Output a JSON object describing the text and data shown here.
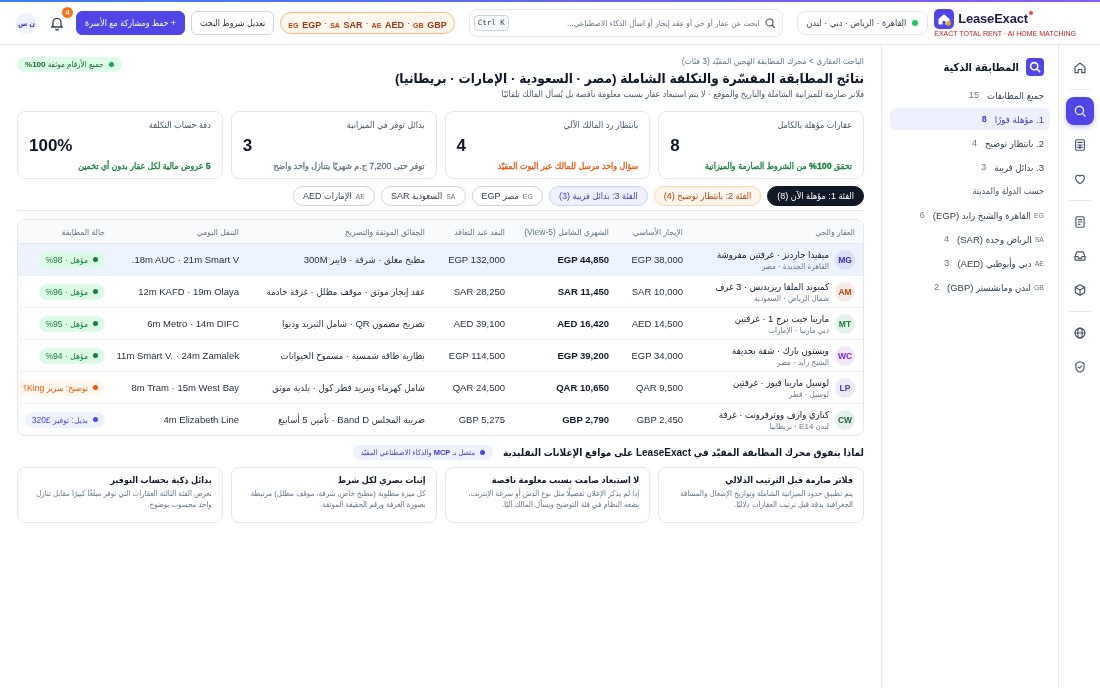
{
  "top_bar": {
    "brand": {
      "name": "LeaseExact",
      "tagline": "EXACT TOTAL RENT · AI HOME MATCHING"
    },
    "location": "القاهرة · الرياض · دبي · لندن",
    "search": {
      "placeholder": "ابحث عن عقار أو حي أو عقد إيجار أو اسأل الذكاء الاصطناعي...",
      "shortcut": "Ctrl K"
    },
    "currencies": {
      "separator": "·",
      "items": [
        {
          "flag": "GB",
          "code": "GBP"
        },
        {
          "flag": "AE",
          "code": "AED"
        },
        {
          "flag": "SA",
          "code": "SAR"
        },
        {
          "flag": "EG",
          "code": "EGP"
        }
      ]
    },
    "buttons": [
      {
        "label": "تعديل شروط البحث",
        "kind": "secondary"
      },
      {
        "label": "+ حفظ ومشاركة مع الأسرة",
        "kind": "primary"
      }
    ],
    "notifications": "4",
    "user_initials": "ن س"
  },
  "nav_rail": [
    {
      "selected": false
    },
    {
      "selected": true
    },
    {
      "selected": false
    },
    {
      "selected": false
    },
    {
      "selected": false
    },
    {
      "selected": false
    },
    {
      "selected": false
    },
    {
      "selected": false
    },
    {
      "selected": false
    }
  ],
  "sidebar": {
    "title": "المطابقة الذكية",
    "items": [
      {
        "label": "جميع المطابقات",
        "count": "15",
        "selected": false
      },
      {
        "label": "1. مؤهلة فورًا",
        "count": "8",
        "selected": true
      },
      {
        "label": "2. بانتظار توضيح",
        "count": "4",
        "selected": false
      },
      {
        "label": "3. بدائل قريبة",
        "count": "3",
        "selected": false
      }
    ],
    "section": "حسب الدولة والمدينة",
    "regions": [
      {
        "code": "EG",
        "label": "القاهرة والشيخ زايد (EGP)",
        "count": "6",
        "selected": false
      },
      {
        "code": "SA",
        "label": "الرياض وجدة (SAR)",
        "count": "4",
        "selected": false
      },
      {
        "code": "AE",
        "label": "دبي وأبوظبي (AED)",
        "count": "3",
        "selected": false
      },
      {
        "code": "GB",
        "label": "لندن ومانشستر (GBP)",
        "count": "2",
        "selected": false
      }
    ]
  },
  "header": {
    "breadcrumb": "الباحث العقاري > محرك المطابقة الهجين المقيّد (3 فئات)",
    "badge": "جميع الأرقام موثقة **100%**",
    "title": "نتائج المطابقة المفسّرة والتكلفة الشاملة (مصر · السعودية · الإمارات · بريطانيا)",
    "subtitle": "فلاتر صارمة للميزانية الشاملة والتاريخ والموقع · لا يتم استبعاد عقار بسبب معلومة ناقصة بل يُسأل المالك تلقائيًا"
  },
  "stats": [
    {
      "label": "عقارات مؤهلة بالكامل",
      "value": "8",
      "note": "تحقق **100%** من الشروط الصارمة والميزانية",
      "color": "#15803d"
    },
    {
      "label": "بانتظار رد المالك الآلي",
      "value": "4",
      "note": "سؤال واحد مرسل للمالك عبر البوت المقيّد",
      "color": "#ea580c"
    },
    {
      "label": "بدائل توفر في الميزانية",
      "value": "3",
      "note": "توفر حتى 7,200 ج.م شهريًا بتنازل واحد واضح",
      "color": "#64748b"
    },
    {
      "label": "دقة حساب التكلفة",
      "value": "100%",
      "note": "**5** عروض مالية لكل عقار بدون أي تخمين",
      "color": "#15803d"
    }
  ],
  "filters": [
    {
      "label": "الفئة 1: مؤهلة الآن (8)",
      "kind": "ready",
      "selected": true
    },
    {
      "label": "الفئة 2: بانتظار توضيح (4)",
      "kind": "clarify",
      "selected": false
    },
    {
      "label": "الفئة 3: بدائل قريبة (3)",
      "kind": "alternative",
      "selected": false
    },
    {
      "code": "EG",
      "label": "مصر EGP",
      "kind": "country",
      "selected": false
    },
    {
      "code": "SA",
      "label": "السعودية SAR",
      "kind": "country",
      "selected": false
    },
    {
      "code": "AE",
      "label": "الإمارات AED",
      "kind": "country",
      "selected": false
    }
  ],
  "table": {
    "columns": [
      "العقار والحي",
      "الإيجار الأساسي",
      "الشهري الشامل (View-5)",
      "النقد عند التعاقد",
      "الحقائق الموثقة والتصريح",
      "التنقل اليومي",
      "حالة المطابقة"
    ],
    "rows": [
      {
        "initials": "MG",
        "color": "#3730a3",
        "name": "ميفيدا جاردنز · غرفتين مفروشة",
        "area": "القاهرة الجديدة · مصر",
        "base_rent": "EGP 38,000",
        "monthly_total": "EGP 44,850",
        "move_in_cash": "EGP 132,000",
        "facts": "مطبخ مغلق · شرفة · فايبر 300M",
        "commute": "18m AUC · 21m Smart V.",
        "status": {
          "label": "مؤهل · 98%",
          "kind": "qualified"
        },
        "selected": true
      },
      {
        "initials": "AM",
        "color": "#c2410c",
        "name": "كمبوند الملقا ريزيدنس · 3 غرف",
        "area": "شمال الرياض · السعودية",
        "base_rent": "SAR 10,000",
        "monthly_total": "SAR 11,450",
        "move_in_cash": "SAR 28,250",
        "facts": "عقد إيجار موثق · موقف مظلل · غرفة خادمة",
        "commute": "12m KAFD · 19m Olaya",
        "status": {
          "label": "مؤهل · 96%",
          "kind": "qualified"
        },
        "selected": false
      },
      {
        "initials": "MT",
        "color": "#15803d",
        "name": "مارينا جيت برج 1 · غرفتين",
        "area": "دبي مارينا · الإمارات",
        "base_rent": "AED 14,500",
        "monthly_total": "AED 16,420",
        "move_in_cash": "AED 39,100",
        "facts": "تصريح مضمون QR · شامل التبريد وديوا",
        "commute": "6m Metro · 14m DIFC",
        "status": {
          "label": "مؤهل · 95%",
          "kind": "qualified"
        },
        "selected": false
      },
      {
        "initials": "WC",
        "color": "#7e22ce",
        "name": "ويستون بارك · شقة بحديقة",
        "area": "الشيخ زايد · مصر",
        "base_rent": "EGP 34,000",
        "monthly_total": "EGP 39,200",
        "move_in_cash": "EGP 114,500",
        "facts": "بطارية طاقة شمسية · مسموح الحيوانات",
        "commute": "11m Smart V. · 24m Zamalek",
        "status": {
          "label": "مؤهل · 94%",
          "kind": "qualified"
        },
        "selected": false
      },
      {
        "initials": "LP",
        "color": "#4338ca",
        "name": "لوسيل مارينا فيوز · غرفتين",
        "area": "لوسيل · قطر",
        "base_rent": "QAR 9,500",
        "monthly_total": "QAR 10,650",
        "move_in_cash": "QAR 24,500",
        "facts": "شامل كهرماء وتبريد قطر كول · بلدية موثق",
        "commute": "8m Tram · 15m West Bay",
        "status": {
          "label": "توضيح: سرير King؟",
          "kind": "clarify"
        },
        "selected": false
      },
      {
        "initials": "CW",
        "color": "#166534",
        "name": "كناري وارف ووترفرونت · غرفة",
        "area": "لندن E14 · بريطانيا",
        "base_rent": "GBP 2,450",
        "monthly_total": "GBP 2,790",
        "move_in_cash": "GBP 5,275",
        "facts": "ضريبة المجلس Band D · تأمين 5 أسابيع",
        "commute": "4m Elizabeth Line",
        "status": {
          "label": "بديل: توفير £320",
          "kind": "alternative"
        },
        "selected": false
      }
    ]
  },
  "why_section": {
    "title": "لماذا يتفوق محرك المطابقة المقيّد في LeaseExact على مواقع الإعلانات التقليدية",
    "badge": "متصل بـ **MCP** والذكاء الاصطناعي المقيّد",
    "cards": [
      {
        "title": "فلاتر صارمة قبل الترتيب الدلالي",
        "text": "يتم تطبيق حدود الميزانية الشاملة وتواريخ الإشغال والمسافة الجغرافية بدقة قبل ترتيب العقارات دلاليًا."
      },
      {
        "title": "لا استبعاد صامت بسبب معلومة ناقصة",
        "text": "إذا لم يذكر الإعلان تفصيلًا مثل نوع الدش أو سرعة الإنترنت، يضعه النظام في فئة التوضيح ويسأل المالك آليًا."
      },
      {
        "title": "إثبات بصري لكل شرط",
        "text": "كل ميزة مطلوبة (مطبخ خاص، شرفة، موقف مظلل) مرتبطة بصورة الغرفة ورقم الحقيقة الموثقة."
      },
      {
        "title": "بدائل ذكية بحساب التوفير",
        "text": "تعرض الفئة الثالثة العقارات التي توفر مبلغًا كبيرًا مقابل تنازل واحد محسوب بوضوح."
      }
    ]
  }
}
